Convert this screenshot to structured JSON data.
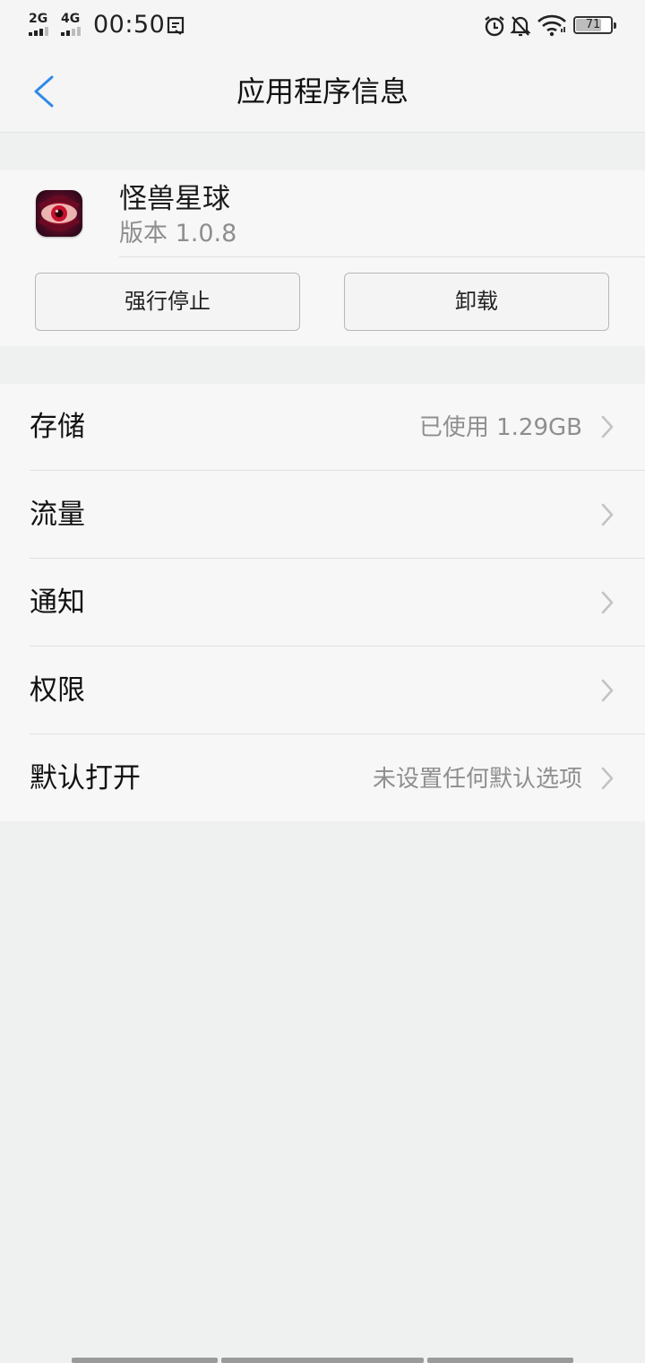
{
  "status_bar": {
    "sim1_label": "2G",
    "sim2_label": "4G",
    "time": "00:50",
    "battery_level": "71",
    "icons": [
      "signal-2g-icon",
      "signal-4g-icon",
      "screenshot-icon",
      "alarm-icon",
      "notifications-off-icon",
      "wifi-icon",
      "battery-icon"
    ]
  },
  "header": {
    "title": "应用程序信息",
    "back_icon": "chevron-left-icon"
  },
  "app": {
    "name": "怪兽星球",
    "version": "版本 1.0.8",
    "force_stop_label": "强行停止",
    "uninstall_label": "卸载"
  },
  "settings": [
    {
      "label": "存储",
      "value": "已使用 1.29GB"
    },
    {
      "label": "流量",
      "value": ""
    },
    {
      "label": "通知",
      "value": ""
    },
    {
      "label": "权限",
      "value": ""
    },
    {
      "label": "默认打开",
      "value": "未设置任何默认选项"
    }
  ],
  "colors": {
    "accent": "#2f8ae6",
    "background": "#eff0f0",
    "secondary_text": "#8f8f8f"
  }
}
